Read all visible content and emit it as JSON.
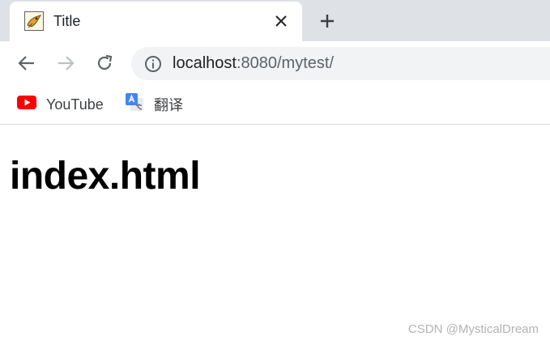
{
  "tab": {
    "title": "Title",
    "favicon": "tomcat-icon"
  },
  "toolbar": {
    "back_icon": "back-arrow-icon",
    "forward_icon": "forward-arrow-icon",
    "reload_icon": "reload-icon",
    "url_host": "localhost",
    "url_rest": ":8080/mytest/"
  },
  "bookmarks": [
    {
      "label": "YouTube",
      "icon": "youtube-icon"
    },
    {
      "label": "翻译",
      "icon": "google-translate-icon"
    }
  ],
  "page": {
    "heading": "index.html"
  },
  "watermark": "CSDN @MysticalDream",
  "colors": {
    "tabstrip": "#dee1e6",
    "omnibox": "#f1f3f4",
    "youtube_red": "#ff0000",
    "translate_blue": "#4285f4"
  }
}
